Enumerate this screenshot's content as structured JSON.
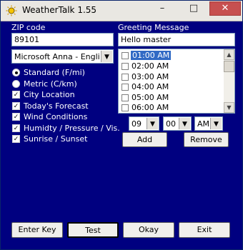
{
  "window": {
    "title": "WeatherTalk 1.55"
  },
  "titlebar": {
    "minimize": "–",
    "maximize": "□",
    "close": "✕"
  },
  "zip": {
    "label": "ZIP code",
    "value": "89101"
  },
  "greeting": {
    "label": "Greeting Message",
    "value": "Hello master"
  },
  "voice": {
    "value": "Microsoft Anna - English ("
  },
  "units": [
    {
      "label": "Standard (F/mi)",
      "selected": true
    },
    {
      "label": "Metric (C/km)",
      "selected": false
    }
  ],
  "options": [
    {
      "label": "City Location",
      "checked": true
    },
    {
      "label": "Today's Forecast",
      "checked": true
    },
    {
      "label": "Wind Conditions",
      "checked": true
    },
    {
      "label": "Humidty / Pressure  / Vis.",
      "checked": true
    },
    {
      "label": "Sunrise / Sunset",
      "checked": true
    }
  ],
  "alarm_times": [
    "01:00 AM",
    "02:00 AM",
    "03:00 AM",
    "04:00 AM",
    "05:00 AM",
    "06:00 AM"
  ],
  "time_select": {
    "hour": "09",
    "minute": "00",
    "ampm": "AM"
  },
  "buttons": {
    "add": "Add",
    "remove": "Remove",
    "enter_key": "Enter Key",
    "test": "Test",
    "okay": "Okay",
    "exit": "Exit"
  }
}
